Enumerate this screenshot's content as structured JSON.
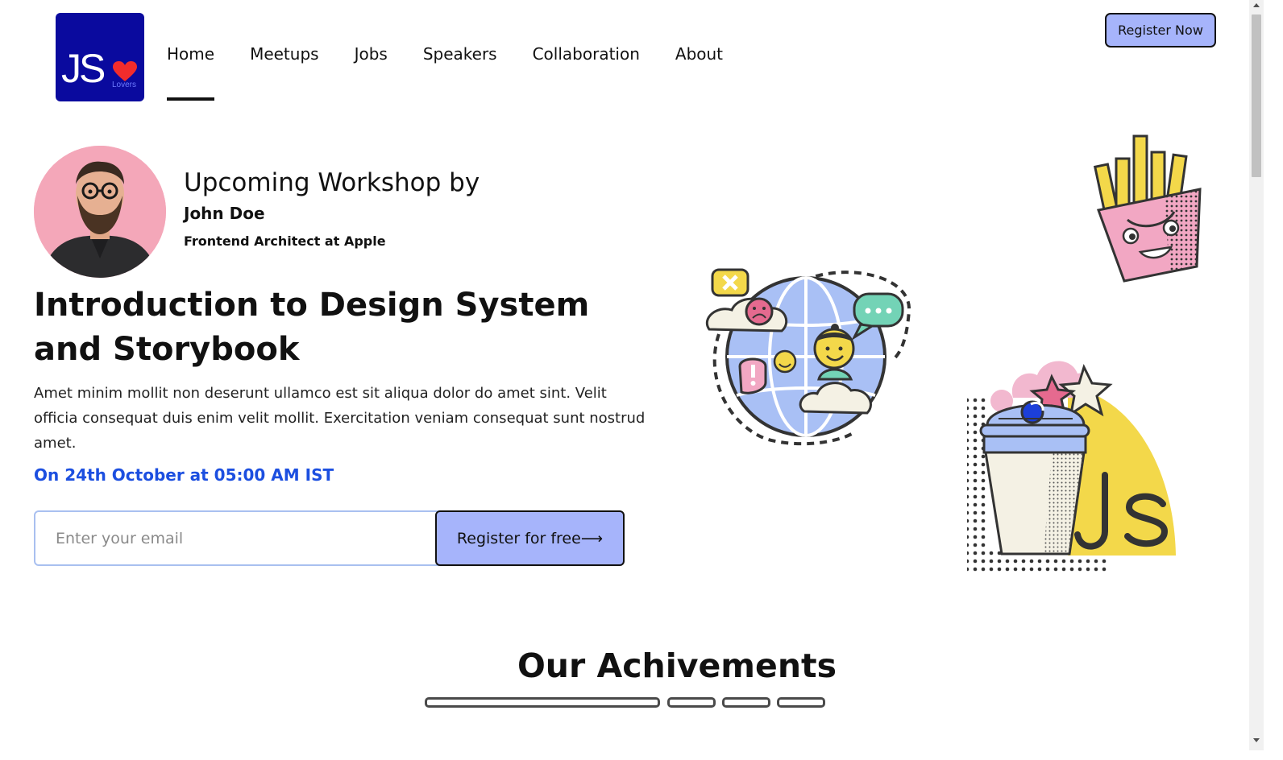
{
  "header": {
    "logo": {
      "text": "JS",
      "sub": "Lovers"
    },
    "nav": [
      {
        "label": "Home",
        "active": true
      },
      {
        "label": "Meetups",
        "active": false
      },
      {
        "label": "Jobs",
        "active": false
      },
      {
        "label": "Speakers",
        "active": false
      },
      {
        "label": "Collaboration",
        "active": false
      },
      {
        "label": "About",
        "active": false
      }
    ],
    "register_label": "Register Now"
  },
  "workshop": {
    "heading": "Upcoming Workshop by",
    "speaker_name": "John Doe",
    "speaker_role": "Frontend Architect at Apple",
    "title": "Introduction to Design System and Storybook",
    "description": "Amet minim mollit non deserunt ullamco est sit aliqua dolor do amet sint. Velit officia consequat duis enim velit mollit. Exercitation veniam consequat sunt nostrud amet.",
    "date": "On 24th October at 05:00 AM IST",
    "email_placeholder": "Enter your email",
    "register_free_label": "Register for free⟶"
  },
  "achievements": {
    "title": "Our Achivements"
  },
  "colors": {
    "logo_bg": "#0a0a9e",
    "accent_button": "#a6b4fb",
    "date_text": "#1c4fe0",
    "heart": "#f22c2c"
  }
}
